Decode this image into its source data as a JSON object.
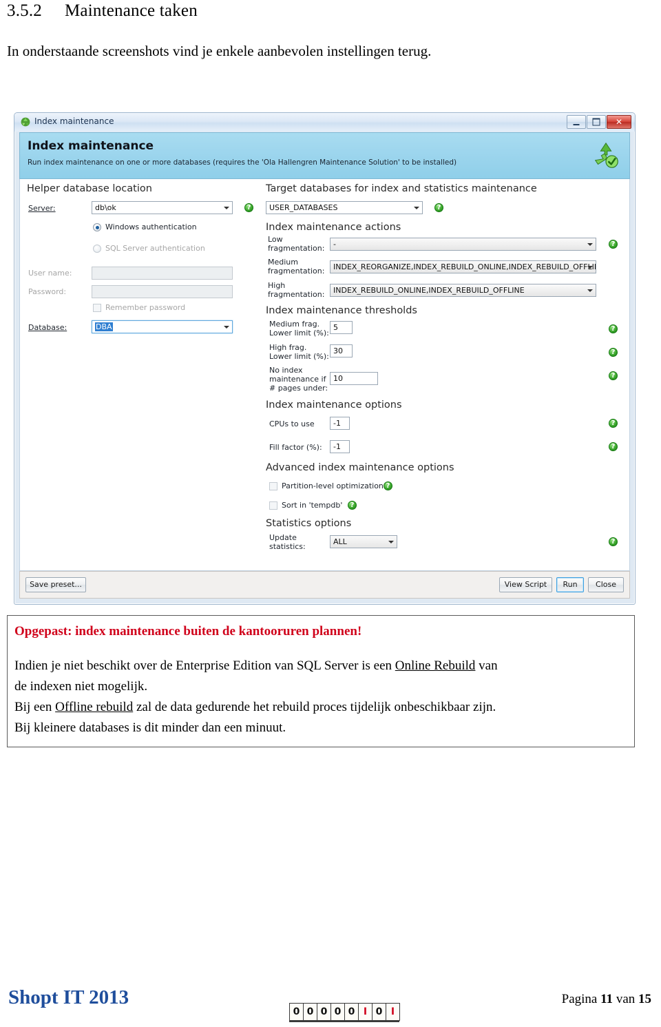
{
  "document": {
    "heading_number": "3.5.2",
    "heading_text": "Maintenance taken",
    "intro": "In onderstaande screenshots vind je enkele aanbevolen instellingen terug."
  },
  "window": {
    "title": "Index maintenance",
    "title_icon": "index-maintenance-icon",
    "minimize_label": "–",
    "maximize_label": "□",
    "close_label": "✕",
    "banner": {
      "heading": "Index maintenance",
      "subtitle": "Run index maintenance on one or more databases (requires the 'Ola Hallengren Maintenance Solution' to be installed)",
      "icon": "green-recycle-check-icon"
    },
    "left_panel": {
      "section_title": "Helper database location",
      "server_label": "Server:",
      "server_value": "db\\ok",
      "windows_auth_label": "Windows authentication",
      "windows_auth_selected": true,
      "sql_auth_label": "SQL Server authentication",
      "sql_auth_selected": false,
      "username_label": "User name:",
      "username_value": "",
      "password_label": "Password:",
      "password_value": "",
      "remember_password_label": "Remember password",
      "remember_password_checked": false,
      "database_label": "Database:",
      "database_value": "DBA"
    },
    "right_panel": {
      "target_section_title": "Target databases for index and statistics maintenance",
      "target_value": "USER_DATABASES",
      "actions_section_title": "Index maintenance actions",
      "low_frag_label_l1": "Low",
      "low_frag_label_l2": "fragmentation:",
      "low_frag_value": "-",
      "medium_frag_label_l1": "Medium",
      "medium_frag_label_l2": "fragmentation:",
      "medium_frag_value": "INDEX_REORGANIZE,INDEX_REBUILD_ONLINE,INDEX_REBUILD_OFFLINE",
      "high_frag_label_l1": "High",
      "high_frag_label_l2": "fragmentation:",
      "high_frag_value": "INDEX_REBUILD_ONLINE,INDEX_REBUILD_OFFLINE",
      "thresholds_section_title": "Index maintenance thresholds",
      "medium_limit_label_l1": "Medium frag.",
      "medium_limit_label_l2": "Lower limit (%):",
      "medium_limit_value": "5",
      "high_limit_label_l1": "High frag.",
      "high_limit_label_l2": "Lower limit (%):",
      "high_limit_value": "30",
      "no_maint_label_l1": "No index",
      "no_maint_label_l2": "maintenance if",
      "no_maint_label_l3": "# pages under:",
      "no_maint_value": "10",
      "options_section_title": "Index maintenance options",
      "cpus_label": "CPUs to use",
      "cpus_value": "-1",
      "fill_factor_label": "Fill factor (%):",
      "fill_factor_value": "-1",
      "advanced_section_title": "Advanced index maintenance options",
      "partition_label": "Partition-level optimization",
      "partition_checked": false,
      "sort_tempdb_label": "Sort in 'tempdb'",
      "sort_tempdb_checked": false,
      "statistics_section_title": "Statistics options",
      "update_stats_label_l1": "Update",
      "update_stats_label_l2": "statistics:",
      "update_stats_value": "ALL"
    },
    "footer_buttons": {
      "save_preset": "Save preset...",
      "view_script": "View Script",
      "run": "Run",
      "close": "Close"
    }
  },
  "note": {
    "warning": "Opgepast: index maintenance buiten de kantooruren plannen!",
    "line1_a": "Indien je niet beschikt over de Enterprise Edition van SQL Server is een ",
    "line1_link": "Online Rebuild",
    "line1_b": " van",
    "line2": "de indexen niet mogelijk.",
    "line3_a": "Bij een ",
    "line3_link": "Offline rebuild",
    "line3_b": " zal de data gedurende het rebuild proces tijdelijk onbeschikbaar zijn.",
    "line4": "Bij kleinere databases is dit minder dan een minuut."
  },
  "page_footer": {
    "brand": "Shopt IT 2013",
    "page_prefix": "Pagina ",
    "page_number": "11",
    "page_middle": " van ",
    "page_total": "15",
    "counter_digits": [
      "0",
      "0",
      "0",
      "0",
      "0",
      "I",
      "0",
      "I"
    ],
    "counter_colors": [
      "blk",
      "blk",
      "blk",
      "blk",
      "blk",
      "red",
      "blk",
      "red"
    ]
  },
  "colors": {
    "warning_red": "#d0021b",
    "brand_blue": "#1f4e9c",
    "banner_blue": "#9ed6ee",
    "selection_blue": "#2f7fd1",
    "help_green": "#3aa62c"
  }
}
